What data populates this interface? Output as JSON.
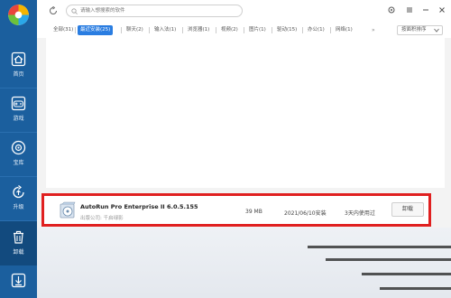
{
  "sidebar": {
    "items": [
      {
        "label": "首页",
        "icon": "home-icon"
      },
      {
        "label": "游戏",
        "icon": "gamepad-icon"
      },
      {
        "label": "宝库",
        "icon": "store-icon"
      },
      {
        "label": "升级",
        "icon": "upgrade-icon"
      },
      {
        "label": "卸载",
        "icon": "uninstall-icon"
      },
      {
        "label": "",
        "icon": "download-icon"
      }
    ]
  },
  "search": {
    "placeholder": "请输入想搜索的软件"
  },
  "tabs": [
    {
      "label": "全部(31)"
    },
    {
      "label": "最近安装(25)"
    },
    {
      "label": "聊天(2)"
    },
    {
      "label": "输入法(1)"
    },
    {
      "label": "浏览器(1)"
    },
    {
      "label": "视频(2)"
    },
    {
      "label": "图片(1)"
    },
    {
      "label": "驱动(15)"
    },
    {
      "label": "办公(1)"
    },
    {
      "label": "网络(1)"
    }
  ],
  "tab_more": "»",
  "sort_label": "按面积排序",
  "app_row": {
    "name": "AutoRun Pro Enterprise II 6.0.5.155",
    "publisher": "出版公司: 千启绿影",
    "size": "39 MB",
    "date": "2021/06/10安装",
    "usage": "3天内使用过",
    "uninstall_label": "卸载"
  },
  "colors": {
    "sidebar": "#1b5f9e",
    "accent": "#2a7de1",
    "highlight": "#e02020"
  }
}
